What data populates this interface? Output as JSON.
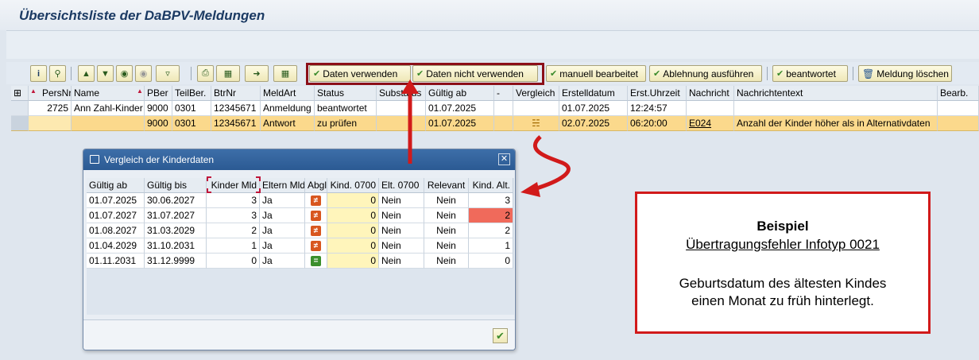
{
  "title": "Übersichtsliste der DaBPV-Meldungen",
  "toolbar": {
    "btn_use": "Daten verwenden",
    "btn_not_use": "Daten nicht verwenden",
    "btn_manual": "manuell bearbeitet",
    "btn_reject": "Ablehnung ausführen",
    "btn_answered": "beantwortet",
    "btn_delete": "Meldung löschen"
  },
  "grid": {
    "headers": {
      "persnr": "PersNr",
      "name": "Name",
      "pber": "PBer",
      "teilber": "TeilBer.",
      "btrnr": "BtrNr",
      "meldart": "MeldArt",
      "status": "Status",
      "substatus": "Substatus",
      "gueltig_ab": "Gültig ab",
      "dash": "-",
      "vergleich": "Vergleich",
      "erstelldatum": "Erstelldatum",
      "erst_uhrzeit": "Erst.Uhrzeit",
      "nachricht": "Nachricht",
      "nachrichtentext": "Nachrichtentext",
      "bearb": "Bearb."
    },
    "row1": {
      "persnr": "2725",
      "name": "Ann Zahl-Kinder",
      "pber": "9000",
      "teilber": "0301",
      "btrnr": "12345671",
      "meldart": "Anmeldung",
      "status": "beantwortet",
      "gueltig_ab": "01.07.2025",
      "erstelldatum": "01.07.2025",
      "erst_uhrzeit": "12:24:57"
    },
    "row2": {
      "pber": "9000",
      "teilber": "0301",
      "btrnr": "12345671",
      "meldart": "Antwort",
      "status": "zu prüfen",
      "gueltig_ab": "01.07.2025",
      "erstelldatum": "02.07.2025",
      "erst_uhrzeit": "06:20:00",
      "nachricht": "E024",
      "nachrichtentext": "Anzahl der Kinder höher als in Alternativdaten"
    }
  },
  "dialog": {
    "title": "Vergleich der Kinderdaten",
    "headers": {
      "gueltig_ab": "Gültig ab",
      "gueltig_bis": "Gültig bis",
      "kinder_mld": "Kinder Mld",
      "eltern_mld": "Eltern Mld",
      "abgl": "Abgl",
      "kind_0700": "Kind. 0700",
      "elt_0700": "Elt. 0700",
      "relevant": "Relevant",
      "kind_alt": "Kind. Alt."
    },
    "rows": [
      {
        "gueltig_ab": "01.07.2025",
        "gueltig_bis": "30.06.2027",
        "kinder_mld": "3",
        "eltern_mld": "Ja",
        "abgl": "≠",
        "kind_0700": "0",
        "elt_0700": "Nein",
        "relevant": "Nein",
        "kind_alt": "3"
      },
      {
        "gueltig_ab": "01.07.2027",
        "gueltig_bis": "31.07.2027",
        "kinder_mld": "3",
        "eltern_mld": "Ja",
        "abgl": "≠",
        "kind_0700": "0",
        "elt_0700": "Nein",
        "relevant": "Nein",
        "kind_alt": "2"
      },
      {
        "gueltig_ab": "01.08.2027",
        "gueltig_bis": "31.03.2029",
        "kinder_mld": "2",
        "eltern_mld": "Ja",
        "abgl": "≠",
        "kind_0700": "0",
        "elt_0700": "Nein",
        "relevant": "Nein",
        "kind_alt": "2"
      },
      {
        "gueltig_ab": "01.04.2029",
        "gueltig_bis": "31.10.2031",
        "kinder_mld": "1",
        "eltern_mld": "Ja",
        "abgl": "≠",
        "kind_0700": "0",
        "elt_0700": "Nein",
        "relevant": "Nein",
        "kind_alt": "1"
      },
      {
        "gueltig_ab": "01.11.2031",
        "gueltig_bis": "31.12.9999",
        "kinder_mld": "0",
        "eltern_mld": "Ja",
        "abgl": "=",
        "kind_0700": "0",
        "elt_0700": "Nein",
        "relevant": "Nein",
        "kind_alt": "0"
      }
    ]
  },
  "note": {
    "title": "Beispiel",
    "subtitle": "Übertragungsfehler Infotyp 0021",
    "line1": "Geburtsdatum des ältesten Kindes",
    "line2": "einen Monat zu früh hinterlegt."
  },
  "colors": {
    "annotation_red": "#d11a1a",
    "highlight_dark_red": "#8c0f18",
    "selected_row": "#fbd98c",
    "mismatch_cell": "#f06a5b"
  }
}
